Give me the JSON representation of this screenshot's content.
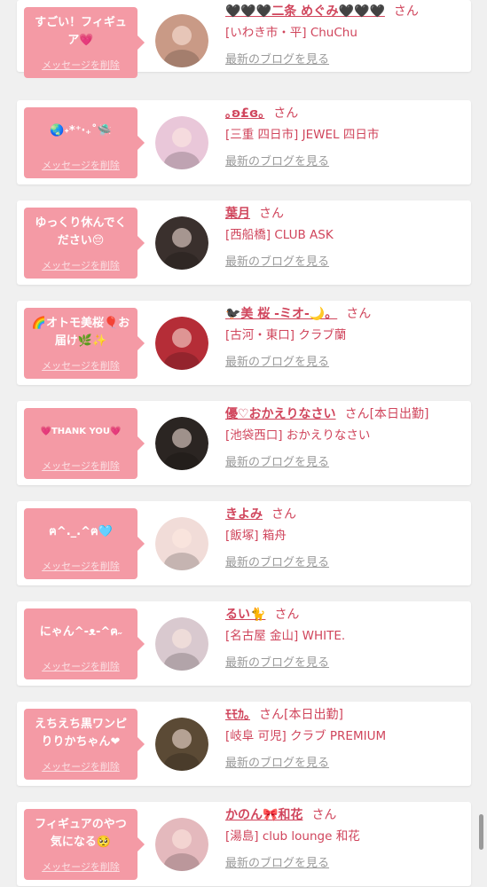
{
  "messages": [
    {
      "bubble_text": "すごい！フィギュア💗",
      "delete_label": "メッセージを削除",
      "name": "🖤🖤🖤二条 めぐみ🖤🖤🖤",
      "honorific": "さん",
      "status": "",
      "area": "[いわき市・平] ChuChu",
      "blog_link": "最新のブログを見る",
      "avatar_color": "#c99a86"
    },
    {
      "bubble_text": "🌏˖*⁺‧₊˚🛸",
      "delete_label": "メッセージを削除",
      "name": "｡ʚ£ɞ｡",
      "honorific": "さん",
      "status": "",
      "area": "[三重 四日市] JEWEL 四日市",
      "blog_link": "最新のブログを見る",
      "avatar_color": "#e9c7d9"
    },
    {
      "bubble_text": "ゆっくり休んでください😔",
      "delete_label": "メッセージを削除",
      "name": "葉月",
      "honorific": "さん",
      "status": "",
      "area": "[西船橋] CLUB ASK",
      "blog_link": "最新のブログを見る",
      "avatar_color": "#3a302d"
    },
    {
      "bubble_text": "🌈オトモ美桜🎈お届け🌿✨",
      "delete_label": "メッセージを削除",
      "name": "🐦‍⬛美 桜 -ミオ-🌙。",
      "honorific": "さん",
      "status": "",
      "area": "[古河・東口] クラブ蘭",
      "blog_link": "最新のブログを見る",
      "avatar_color": "#b52d37"
    },
    {
      "bubble_text": "💗THANK YOU💗",
      "delete_label": "メッセージを削除",
      "name": "優♡おかえりなさい",
      "honorific": "さん",
      "status": "[本日出勤]",
      "area": "[池袋西口] おかえりなさい",
      "blog_link": "最新のブログを見る",
      "avatar_color": "#2b2522"
    },
    {
      "bubble_text": "ฅ^._.^ฅ🩵",
      "delete_label": "メッセージを削除",
      "name": "きよみ",
      "honorific": "さん",
      "status": "",
      "area": "[飯塚] 箱舟",
      "blog_link": "最新のブログを見る",
      "avatar_color": "#f1dcd8"
    },
    {
      "bubble_text": "にゃん^-ᴥ-^ฅ˶",
      "delete_label": "メッセージを削除",
      "name": "るい🐈",
      "honorific": "さん",
      "status": "",
      "area": "[名古屋 金山] WHITE.",
      "blog_link": "最新のブログを見る",
      "avatar_color": "#d9c9cf"
    },
    {
      "bubble_text": "えちえち黒ワンピりりかちゃん❤︎",
      "delete_label": "メッセージを削除",
      "name": "ﾓﾓｶ｡",
      "honorific": "さん",
      "status": "[本日出勤]",
      "area": "[岐阜 可児] クラブ PREMIUM",
      "blog_link": "最新のブログを見る",
      "avatar_color": "#5b4a35"
    },
    {
      "bubble_text": "フィギュアのやつ気になる🥺",
      "delete_label": "メッセージを削除",
      "name": "かのん🎀和花",
      "honorific": "さん",
      "status": "",
      "area": "[湯島] club lounge 和花",
      "blog_link": "最新のブログを見る",
      "avatar_color": "#e4b9bd"
    }
  ]
}
